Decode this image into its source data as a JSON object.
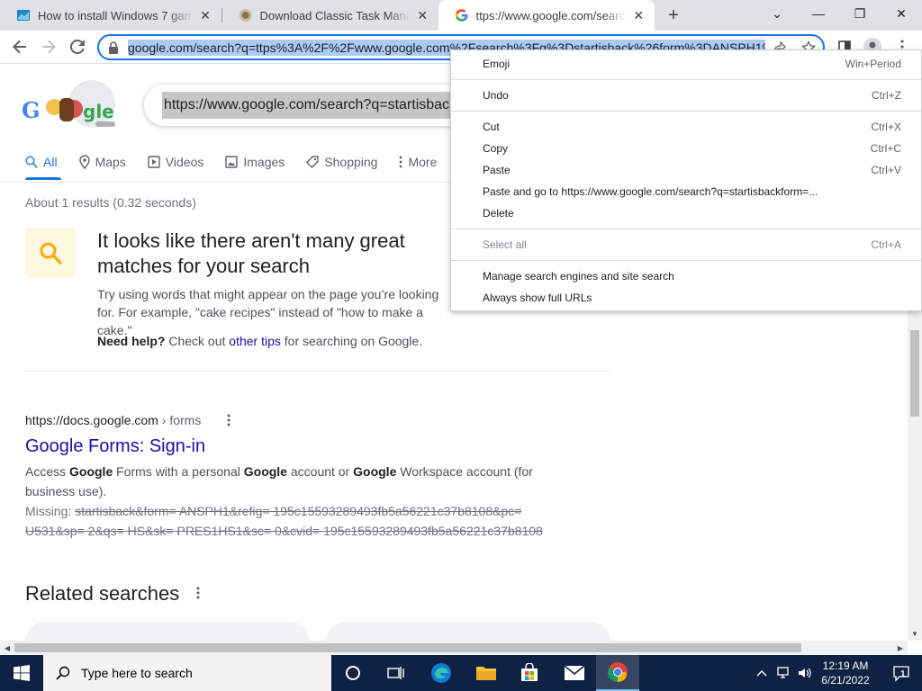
{
  "tabs": [
    {
      "title": "How to install Windows 7 games",
      "close": "✕"
    },
    {
      "title": "Download Classic Task Manager f",
      "close": "✕"
    },
    {
      "title": "ttps://www.google.com/search?q=",
      "close": "✕"
    }
  ],
  "new_tab": "+",
  "window_controls": {
    "tab_search": "⌄",
    "minimize": "—",
    "restore": "❐",
    "close": "✕"
  },
  "address_bar": {
    "url": "google.com/search?q=ttps%3A%2F%2Fwww.google.com%2Fsearch%3Fq%3Dstartisback%26form%3DANSPH1%26"
  },
  "search": {
    "query": "https://www.google.com/search?q=startisback",
    "tabs": [
      "All",
      "Maps",
      "Videos",
      "Images",
      "Shopping",
      "More"
    ],
    "result_stats": "About 1 results (0.32 seconds)"
  },
  "no_results": {
    "title": "It looks like there aren't many great matches for your search",
    "tip": "Try using words that might appear on the page you’re looking for. For example, \"cake recipes\" instead of \"how to make a cake.\"",
    "help_bold": "Need help?",
    "help_pre": " Check out ",
    "help_link": "other tips",
    "help_post": " for searching on Google."
  },
  "result": {
    "cite_domain": "https://docs.google.com",
    "cite_path": " › forms",
    "title": "Google Forms: Sign-in",
    "snippet_parts": [
      "Access ",
      "Google",
      " Forms with a personal ",
      "Google",
      " account or ",
      "Google",
      " Workspace account (for business use)."
    ],
    "missing_label": "Missing: ",
    "missing_terms": "startisback&form= ANSPH1&refig= 195c15593289493fb5a56221c37b8108&pc= U531&sp= 2&qs= HS&sk= PRES1HS1&sc= 0&cvid= 195c15593289493fb5a56221c37b8108"
  },
  "related": {
    "title": "Related searches"
  },
  "context_menu": {
    "items": [
      {
        "label": "Emoji",
        "shortcut": "Win+Period",
        "enabled": true
      },
      {
        "label": "Undo",
        "shortcut": "Ctrl+Z",
        "enabled": true
      },
      {
        "label": "Cut",
        "shortcut": "Ctrl+X",
        "enabled": true
      },
      {
        "label": "Copy",
        "shortcut": "Ctrl+C",
        "enabled": true
      },
      {
        "label": "Paste",
        "shortcut": "Ctrl+V",
        "enabled": true
      },
      {
        "label": "Paste and go to https://www.google.com/search?q=startisbackform=...",
        "shortcut": "",
        "enabled": true
      },
      {
        "label": "Delete",
        "shortcut": "",
        "enabled": true
      },
      {
        "label": "Select all",
        "shortcut": "Ctrl+A",
        "enabled": false
      },
      {
        "label": "Manage search engines and site search",
        "shortcut": "",
        "enabled": true
      },
      {
        "label": "Always show full URLs",
        "shortcut": "",
        "enabled": true
      }
    ]
  },
  "taskbar": {
    "search_placeholder": "Type here to search",
    "apps": [
      "cortana-icon",
      "task-view-icon",
      "edge-icon",
      "file-explorer-icon",
      "store-icon",
      "mail-icon",
      "chrome-icon"
    ],
    "time": "12:19 AM",
    "date": "6/21/2022",
    "notification_count": "1"
  },
  "colors": {
    "accent": "#1a73e8",
    "link": "#1a0dab",
    "taskbar": "#102243"
  }
}
